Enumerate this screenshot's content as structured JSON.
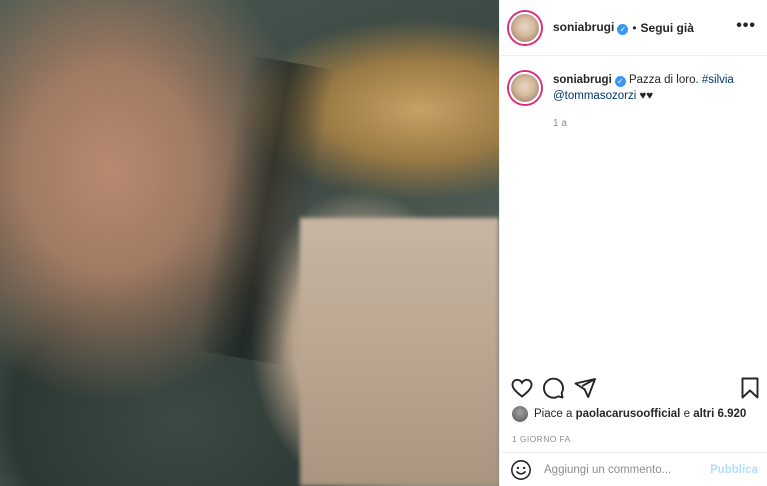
{
  "post": {
    "username": "soniabrugi",
    "follow_state": "Segui già",
    "separator": "•",
    "more_icon": "more-horizontal-icon"
  },
  "caption": {
    "username": "soniabrugi",
    "text": "Pazza di loro.",
    "hashtag": "#silvia",
    "mention": "@tommasozorzi",
    "emoji": "♥♥",
    "time": "1 a"
  },
  "actions": {
    "icons": [
      "heart-icon",
      "comment-icon",
      "share-icon",
      "bookmark-icon"
    ]
  },
  "likes": {
    "prefix": "Piace a",
    "liker": "paolacarusoofficial",
    "middle": "e",
    "others": "altri 6.920"
  },
  "date": "1 GIORNO FA",
  "comment_box": {
    "placeholder": "Aggiungi un commento...",
    "post_label": "Pubblica"
  },
  "colors": {
    "verified": "#3897f0",
    "story_ring": "#dd2a7b",
    "link": "#00376b",
    "post_disabled": "#b2dffc"
  }
}
